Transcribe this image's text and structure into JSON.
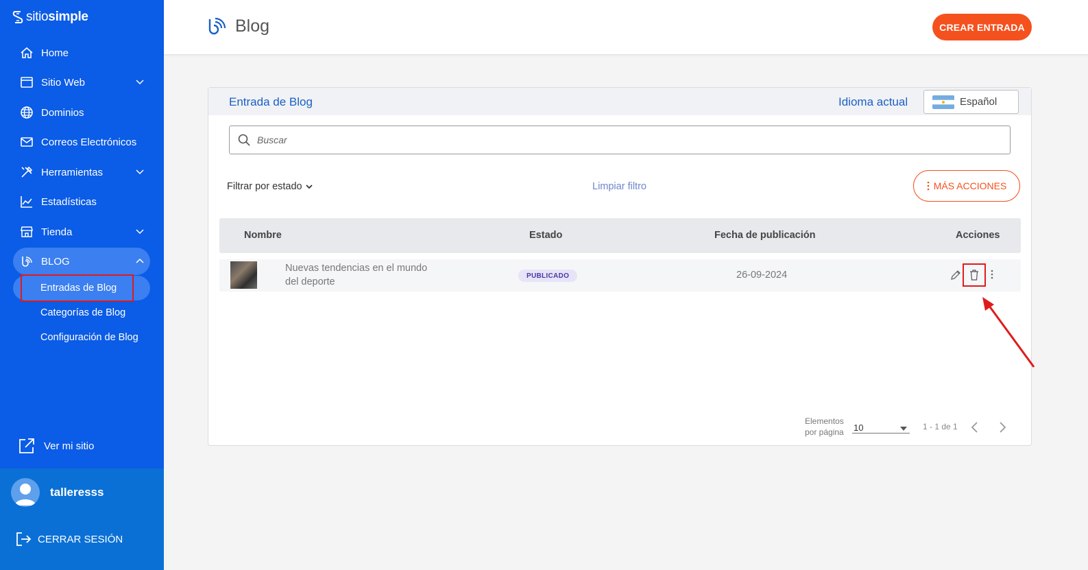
{
  "brand": {
    "light": "sitio",
    "bold": "simple"
  },
  "sidebar": {
    "items": [
      {
        "label": "Home",
        "icon": "home-icon"
      },
      {
        "label": "Sitio Web",
        "icon": "browser-window-icon"
      },
      {
        "label": "Dominios",
        "icon": "globe-icon"
      },
      {
        "label": "Correos Electrónicos",
        "icon": "mail-icon"
      },
      {
        "label": "Herramientas",
        "icon": "tools-icon"
      },
      {
        "label": "Estadísticas",
        "icon": "chart-icon"
      },
      {
        "label": "Tienda",
        "icon": "store-icon"
      },
      {
        "label": "BLOG",
        "icon": "blog-icon"
      }
    ],
    "blog_sub": [
      {
        "label": "Entradas de Blog"
      },
      {
        "label": "Categorías de Blog"
      },
      {
        "label": "Configuración de Blog"
      }
    ],
    "view_site": "Ver mi sitio",
    "username": "talleresss",
    "logout": "CERRAR SESIÓN"
  },
  "header": {
    "title": "Blog",
    "create_button": "CREAR ENTRADA"
  },
  "card": {
    "title": "Entrada de Blog",
    "lang_label": "Idioma actual",
    "lang_value": "Español",
    "search_placeholder": "Buscar",
    "filter_label": "Filtrar por estado",
    "clear_filter": "Limpiar filtro",
    "more_actions": "MÁS ACCIONES"
  },
  "table": {
    "columns": [
      "Nombre",
      "Estado",
      "Fecha de publicación",
      "Acciones"
    ],
    "rows": [
      {
        "name": "Nuevas tendencias en el mundo del deporte",
        "status": "PUBLICADO",
        "date": "26-09-2024"
      }
    ]
  },
  "pagination": {
    "label": "Elementos por página",
    "per_page": "10",
    "range": "1 - 1 de 1"
  },
  "colors": {
    "sidebar": "#0b5ce6",
    "accent": "#f4511e",
    "link": "#1a5fc7",
    "highlight": "#e01b1b"
  }
}
